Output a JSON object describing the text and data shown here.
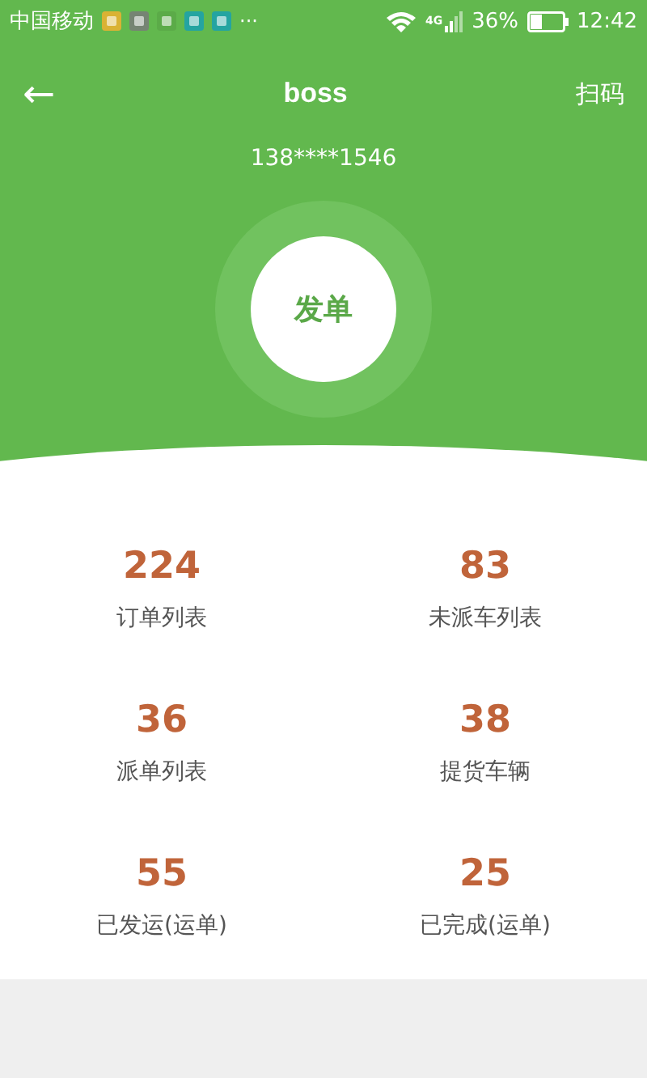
{
  "status_bar": {
    "carrier": "中国移动",
    "more": "···",
    "battery_percent": "36%",
    "network": "4G",
    "time": "12:42"
  },
  "nav": {
    "back": "←",
    "title": "boss",
    "action": "扫码"
  },
  "phone": "138****1546",
  "main_button": "发单",
  "stats": [
    {
      "value": "224",
      "label": "订单列表"
    },
    {
      "value": "83",
      "label": "未派车列表"
    },
    {
      "value": "36",
      "label": "派单列表"
    },
    {
      "value": "38",
      "label": "提货车辆"
    },
    {
      "value": "55",
      "label": "已发运(运单)"
    },
    {
      "value": "25",
      "label": "已完成(运单)"
    }
  ]
}
